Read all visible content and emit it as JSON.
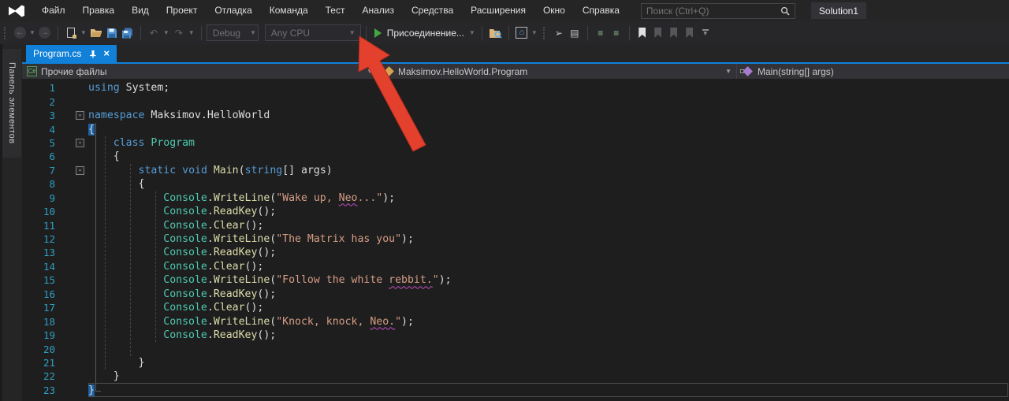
{
  "menu_bar": {
    "items": [
      "Файл",
      "Правка",
      "Вид",
      "Проект",
      "Отладка",
      "Команда",
      "Тест",
      "Анализ",
      "Средства",
      "Расширения",
      "Окно",
      "Справка"
    ]
  },
  "search": {
    "placeholder": "Поиск (Ctrl+Q)"
  },
  "solution_badge": "Solution1",
  "toolbar": {
    "debug_config": "Debug",
    "platform": "Any CPU",
    "start_label": "Присоединение...",
    "fold_glyph": "-",
    "undo_glyph": "↶",
    "redo_glyph": "↷",
    "back_glyph": "←",
    "forward_glyph": "→",
    "home_glyph": "⌂",
    "indent_glyph": "≡",
    "props_glyph": "▤",
    "cursor_glyph": "➢",
    "chevron": "▼"
  },
  "toolbox_tab": {
    "label": "Панель элементов"
  },
  "editor_tab": {
    "title": "Program.cs",
    "close_glyph": "×"
  },
  "navigation_bar": {
    "project": "Прочие файлы",
    "type": "Maksimov.HelloWorld.Program",
    "member": "Main(string[] args)",
    "csharp_icon_text": "C#"
  },
  "colors": {
    "accent_blue": "#1080D8",
    "keyword": "#569CD6",
    "type": "#4EC9B0",
    "method": "#DCDCAA",
    "string": "#D69D85",
    "plain": "#DCDCDC",
    "line_number": "#2F9EC2",
    "brace_highlight_bg": "#1D5FA0",
    "squiggle": "#C24FC2",
    "arrow_red": "#E4402E",
    "run_green": "#41A941"
  },
  "code": {
    "current_line": 23,
    "lines": [
      {
        "n": 1,
        "c": 0,
        "t": [
          [
            "k",
            "using"
          ],
          [
            "p",
            " System;"
          ]
        ]
      },
      {
        "n": 2,
        "c": 0,
        "t": []
      },
      {
        "n": 3,
        "c": 1,
        "t": [
          [
            "k",
            "namespace"
          ],
          [
            "p",
            " Maksimov.HelloWorld"
          ]
        ]
      },
      {
        "n": 4,
        "c": 0,
        "t": [
          [
            "b",
            "{"
          ]
        ]
      },
      {
        "n": 5,
        "c": 1,
        "t": [
          [
            "p",
            "    "
          ],
          [
            "k",
            "class"
          ],
          [
            "p",
            " "
          ],
          [
            "t",
            "Program"
          ]
        ]
      },
      {
        "n": 6,
        "c": 0,
        "t": [
          [
            "p",
            "    {"
          ]
        ]
      },
      {
        "n": 7,
        "c": 1,
        "t": [
          [
            "p",
            "        "
          ],
          [
            "k",
            "static"
          ],
          [
            "p",
            " "
          ],
          [
            "k",
            "void"
          ],
          [
            "p",
            " "
          ],
          [
            "m",
            "Main"
          ],
          [
            "p",
            "("
          ],
          [
            "k",
            "string"
          ],
          [
            "p",
            "[] args)"
          ]
        ]
      },
      {
        "n": 8,
        "c": 0,
        "t": [
          [
            "p",
            "        {"
          ]
        ]
      },
      {
        "n": 9,
        "c": 0,
        "t": [
          [
            "p",
            "            "
          ],
          [
            "t",
            "Console"
          ],
          [
            "p",
            "."
          ],
          [
            "m",
            "WriteLine"
          ],
          [
            "p",
            "("
          ],
          [
            "s",
            "\"Wake up, "
          ],
          [
            "q",
            "Neo"
          ],
          [
            "s",
            "...\""
          ],
          [
            "p",
            ");"
          ]
        ]
      },
      {
        "n": 10,
        "c": 0,
        "t": [
          [
            "p",
            "            "
          ],
          [
            "t",
            "Console"
          ],
          [
            "p",
            "."
          ],
          [
            "m",
            "ReadKey"
          ],
          [
            "p",
            "();"
          ]
        ]
      },
      {
        "n": 11,
        "c": 0,
        "t": [
          [
            "p",
            "            "
          ],
          [
            "t",
            "Console"
          ],
          [
            "p",
            "."
          ],
          [
            "m",
            "Clear"
          ],
          [
            "p",
            "();"
          ]
        ]
      },
      {
        "n": 12,
        "c": 0,
        "t": [
          [
            "p",
            "            "
          ],
          [
            "t",
            "Console"
          ],
          [
            "p",
            "."
          ],
          [
            "m",
            "WriteLine"
          ],
          [
            "p",
            "("
          ],
          [
            "s",
            "\"The Matrix has you\""
          ],
          [
            "p",
            ");"
          ]
        ]
      },
      {
        "n": 13,
        "c": 0,
        "t": [
          [
            "p",
            "            "
          ],
          [
            "t",
            "Console"
          ],
          [
            "p",
            "."
          ],
          [
            "m",
            "ReadKey"
          ],
          [
            "p",
            "();"
          ]
        ]
      },
      {
        "n": 14,
        "c": 0,
        "t": [
          [
            "p",
            "            "
          ],
          [
            "t",
            "Console"
          ],
          [
            "p",
            "."
          ],
          [
            "m",
            "Clear"
          ],
          [
            "p",
            "();"
          ]
        ]
      },
      {
        "n": 15,
        "c": 0,
        "t": [
          [
            "p",
            "            "
          ],
          [
            "t",
            "Console"
          ],
          [
            "p",
            "."
          ],
          [
            "m",
            "WriteLine"
          ],
          [
            "p",
            "("
          ],
          [
            "s",
            "\"Follow the white "
          ],
          [
            "q",
            "rebbit."
          ],
          [
            "s",
            "\""
          ],
          [
            "p",
            ");"
          ]
        ]
      },
      {
        "n": 16,
        "c": 0,
        "t": [
          [
            "p",
            "            "
          ],
          [
            "t",
            "Console"
          ],
          [
            "p",
            "."
          ],
          [
            "m",
            "ReadKey"
          ],
          [
            "p",
            "();"
          ]
        ]
      },
      {
        "n": 17,
        "c": 0,
        "t": [
          [
            "p",
            "            "
          ],
          [
            "t",
            "Console"
          ],
          [
            "p",
            "."
          ],
          [
            "m",
            "Clear"
          ],
          [
            "p",
            "();"
          ]
        ]
      },
      {
        "n": 18,
        "c": 0,
        "t": [
          [
            "p",
            "            "
          ],
          [
            "t",
            "Console"
          ],
          [
            "p",
            "."
          ],
          [
            "m",
            "WriteLine"
          ],
          [
            "p",
            "("
          ],
          [
            "s",
            "\"Knock, knock, "
          ],
          [
            "q",
            "Neo."
          ],
          [
            "s",
            "\""
          ],
          [
            "p",
            ");"
          ]
        ]
      },
      {
        "n": 19,
        "c": 0,
        "t": [
          [
            "p",
            "            "
          ],
          [
            "t",
            "Console"
          ],
          [
            "p",
            "."
          ],
          [
            "m",
            "ReadKey"
          ],
          [
            "p",
            "();"
          ]
        ]
      },
      {
        "n": 20,
        "c": 0,
        "t": []
      },
      {
        "n": 21,
        "c": 0,
        "t": [
          [
            "p",
            "        }"
          ]
        ]
      },
      {
        "n": 22,
        "c": 0,
        "t": [
          [
            "p",
            "    }"
          ]
        ]
      },
      {
        "n": 23,
        "c": 0,
        "t": [
          [
            "b",
            "}"
          ]
        ]
      }
    ]
  }
}
